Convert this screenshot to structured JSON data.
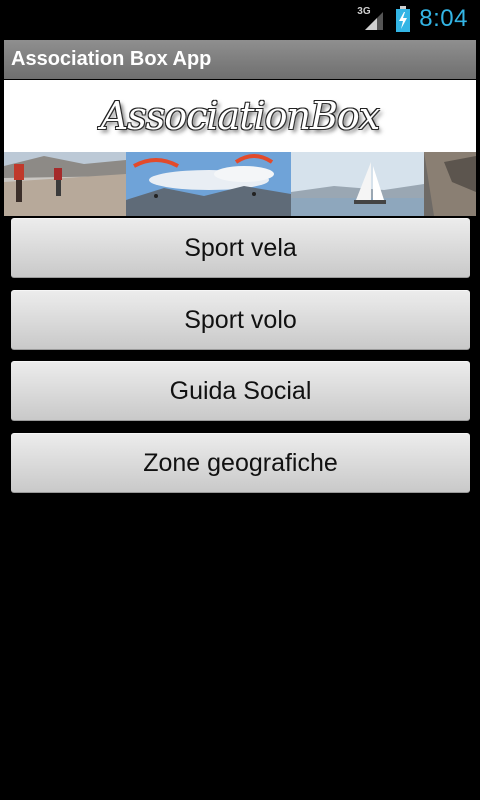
{
  "status_bar": {
    "network_type": "3G",
    "time": "8:04",
    "icons": [
      "signal-3g-icon",
      "battery-charging-icon"
    ]
  },
  "app": {
    "title": "Association Box App"
  },
  "banner": {
    "logo_text": "AssociationBox",
    "photos": [
      "hikers-photo",
      "paragliders-photo",
      "sailboat-photo",
      "rock-photo"
    ]
  },
  "menu": {
    "items": [
      {
        "label": "Sport vela"
      },
      {
        "label": "Sport volo"
      },
      {
        "label": "Guida Social"
      },
      {
        "label": "Zone geografiche"
      }
    ]
  },
  "colors": {
    "clock": "#33b5e5",
    "title_bar": "#7f7f7f",
    "background": "#000000",
    "button": "#d9d9d9"
  }
}
